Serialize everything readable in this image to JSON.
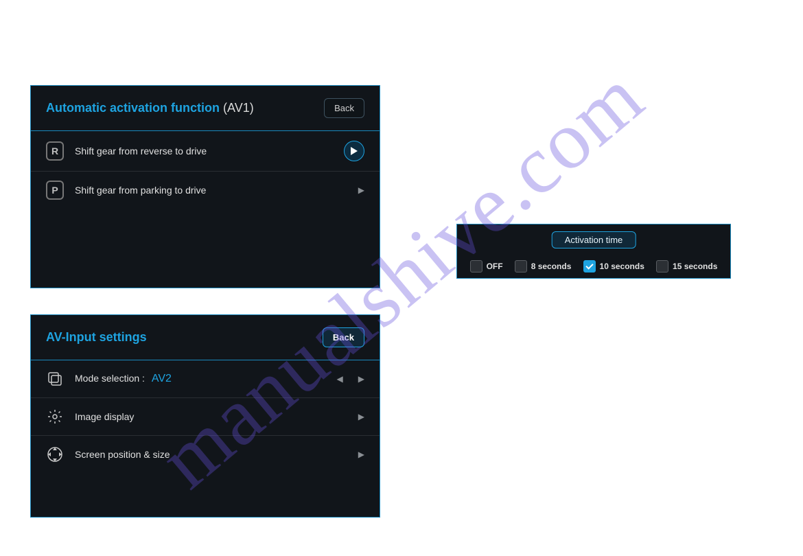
{
  "watermark": "manualshive.com",
  "activation_panel": {
    "title_accent": "Automatic activation function",
    "title_sub": "(AV1)",
    "back_label": "Back",
    "rows": [
      {
        "icon_letter": "R",
        "label": "Shift gear from reverse to drive",
        "selected": true
      },
      {
        "icon_letter": "P",
        "label": "Shift gear from parking to drive",
        "selected": false
      }
    ]
  },
  "time_panel": {
    "title": "Activation time",
    "options": [
      {
        "label": "OFF",
        "checked": false
      },
      {
        "label": "8 seconds",
        "checked": false
      },
      {
        "label": "10 seconds",
        "checked": true
      },
      {
        "label": "15 seconds",
        "checked": false
      }
    ]
  },
  "avinput_panel": {
    "title": "AV-Input settings",
    "back_label": "Back",
    "rows": {
      "mode_selection": {
        "label": "Mode selection :",
        "value": "AV2"
      },
      "image_display": {
        "label": "Image display"
      },
      "screen_pos": {
        "label": "Screen position & size"
      }
    }
  }
}
